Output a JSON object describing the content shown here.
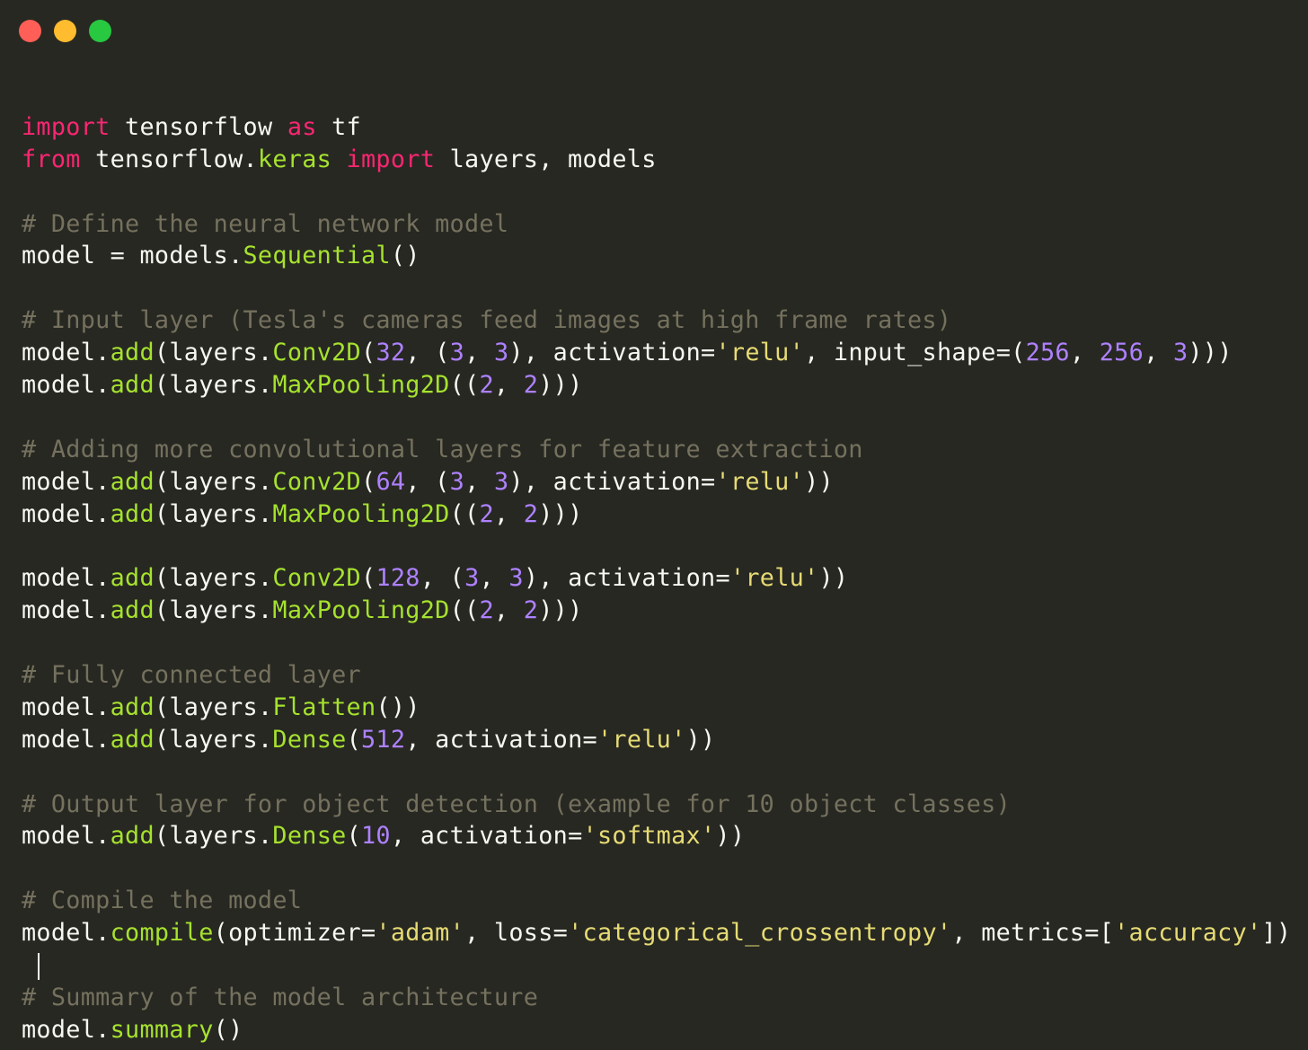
{
  "colors": {
    "background": "#272822",
    "keyword": "#f92672",
    "func": "#a6e22e",
    "number": "#ae81ff",
    "string": "#e6db74",
    "comment": "#75715e",
    "default": "#f8f8f2",
    "close": "#ff5f57",
    "minimize": "#febc2e",
    "maximize": "#28c840"
  },
  "window_controls": [
    {
      "name": "close-button",
      "color": "#ff5f57"
    },
    {
      "name": "minimize-button",
      "color": "#febc2e"
    },
    {
      "name": "maximize-button",
      "color": "#28c840"
    }
  ],
  "code": {
    "cursor_line": 27,
    "lines": [
      [],
      [
        [
          "k",
          "import"
        ],
        [
          "d",
          " tensorflow "
        ],
        [
          "k",
          "as"
        ],
        [
          "d",
          " tf"
        ]
      ],
      [
        [
          "k",
          "from"
        ],
        [
          "d",
          " tensorflow."
        ],
        [
          "f",
          "keras"
        ],
        [
          "d",
          " "
        ],
        [
          "k",
          "import"
        ],
        [
          "d",
          " layers, models"
        ]
      ],
      [],
      [
        [
          "c",
          "# Define the neural network model"
        ]
      ],
      [
        [
          "d",
          "model = models."
        ],
        [
          "f",
          "Sequential"
        ],
        [
          "d",
          "()"
        ]
      ],
      [],
      [
        [
          "c",
          "# Input layer (Tesla's cameras feed images at high frame rates)"
        ]
      ],
      [
        [
          "d",
          "model."
        ],
        [
          "f",
          "add"
        ],
        [
          "d",
          "(layers."
        ],
        [
          "f",
          "Conv2D"
        ],
        [
          "d",
          "("
        ],
        [
          "n",
          "32"
        ],
        [
          "d",
          ", ("
        ],
        [
          "n",
          "3"
        ],
        [
          "d",
          ", "
        ],
        [
          "n",
          "3"
        ],
        [
          "d",
          "), activation="
        ],
        [
          "s",
          "'relu'"
        ],
        [
          "d",
          ", input_shape=("
        ],
        [
          "n",
          "256"
        ],
        [
          "d",
          ", "
        ],
        [
          "n",
          "256"
        ],
        [
          "d",
          ", "
        ],
        [
          "n",
          "3"
        ],
        [
          "d",
          ")))"
        ]
      ],
      [
        [
          "d",
          "model."
        ],
        [
          "f",
          "add"
        ],
        [
          "d",
          "(layers."
        ],
        [
          "f",
          "MaxPooling2D"
        ],
        [
          "d",
          "(("
        ],
        [
          "n",
          "2"
        ],
        [
          "d",
          ", "
        ],
        [
          "n",
          "2"
        ],
        [
          "d",
          ")))"
        ]
      ],
      [],
      [
        [
          "c",
          "# Adding more convolutional layers for feature extraction"
        ]
      ],
      [
        [
          "d",
          "model."
        ],
        [
          "f",
          "add"
        ],
        [
          "d",
          "(layers."
        ],
        [
          "f",
          "Conv2D"
        ],
        [
          "d",
          "("
        ],
        [
          "n",
          "64"
        ],
        [
          "d",
          ", ("
        ],
        [
          "n",
          "3"
        ],
        [
          "d",
          ", "
        ],
        [
          "n",
          "3"
        ],
        [
          "d",
          "), activation="
        ],
        [
          "s",
          "'relu'"
        ],
        [
          "d",
          "))"
        ]
      ],
      [
        [
          "d",
          "model."
        ],
        [
          "f",
          "add"
        ],
        [
          "d",
          "(layers."
        ],
        [
          "f",
          "MaxPooling2D"
        ],
        [
          "d",
          "(("
        ],
        [
          "n",
          "2"
        ],
        [
          "d",
          ", "
        ],
        [
          "n",
          "2"
        ],
        [
          "d",
          ")))"
        ]
      ],
      [],
      [
        [
          "d",
          "model."
        ],
        [
          "f",
          "add"
        ],
        [
          "d",
          "(layers."
        ],
        [
          "f",
          "Conv2D"
        ],
        [
          "d",
          "("
        ],
        [
          "n",
          "128"
        ],
        [
          "d",
          ", ("
        ],
        [
          "n",
          "3"
        ],
        [
          "d",
          ", "
        ],
        [
          "n",
          "3"
        ],
        [
          "d",
          "), activation="
        ],
        [
          "s",
          "'relu'"
        ],
        [
          "d",
          "))"
        ]
      ],
      [
        [
          "d",
          "model."
        ],
        [
          "f",
          "add"
        ],
        [
          "d",
          "(layers."
        ],
        [
          "f",
          "MaxPooling2D"
        ],
        [
          "d",
          "(("
        ],
        [
          "n",
          "2"
        ],
        [
          "d",
          ", "
        ],
        [
          "n",
          "2"
        ],
        [
          "d",
          ")))"
        ]
      ],
      [],
      [
        [
          "c",
          "# Fully connected layer"
        ]
      ],
      [
        [
          "d",
          "model."
        ],
        [
          "f",
          "add"
        ],
        [
          "d",
          "(layers."
        ],
        [
          "f",
          "Flatten"
        ],
        [
          "d",
          "())"
        ]
      ],
      [
        [
          "d",
          "model."
        ],
        [
          "f",
          "add"
        ],
        [
          "d",
          "(layers."
        ],
        [
          "f",
          "Dense"
        ],
        [
          "d",
          "("
        ],
        [
          "n",
          "512"
        ],
        [
          "d",
          ", activation="
        ],
        [
          "s",
          "'relu'"
        ],
        [
          "d",
          "))"
        ]
      ],
      [],
      [
        [
          "c",
          "# Output layer for object detection (example for 10 object classes)"
        ]
      ],
      [
        [
          "d",
          "model."
        ],
        [
          "f",
          "add"
        ],
        [
          "d",
          "(layers."
        ],
        [
          "f",
          "Dense"
        ],
        [
          "d",
          "("
        ],
        [
          "n",
          "10"
        ],
        [
          "d",
          ", activation="
        ],
        [
          "s",
          "'softmax'"
        ],
        [
          "d",
          "))"
        ]
      ],
      [],
      [
        [
          "c",
          "# Compile the model"
        ]
      ],
      [
        [
          "d",
          "model."
        ],
        [
          "f",
          "compile"
        ],
        [
          "d",
          "(optimizer="
        ],
        [
          "s",
          "'adam'"
        ],
        [
          "d",
          ", loss="
        ],
        [
          "s",
          "'categorical_crossentropy'"
        ],
        [
          "d",
          ", metrics=["
        ],
        [
          "s",
          "'accuracy'"
        ],
        [
          "d",
          "])"
        ]
      ],
      [],
      [
        [
          "c",
          "# Summary of the model architecture"
        ]
      ],
      [
        [
          "d",
          "model."
        ],
        [
          "f",
          "summary"
        ],
        [
          "d",
          "()"
        ]
      ]
    ]
  }
}
